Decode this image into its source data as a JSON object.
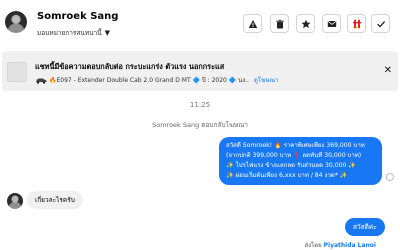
{
  "header": {
    "contact_name": "Somroek Sang",
    "assign_label": "มอบหมายการสนทนานี้",
    "tools": [
      "alert-icon",
      "trash-icon",
      "star-icon",
      "envelope-icon",
      "spam-icon",
      "check-icon"
    ]
  },
  "notice": {
    "title": "แชทนี้มีข้อความตอบกลับต่อ กระบะแกร่ง ตัวแรง นอกกระแส",
    "car_text": "🔥E097 - Extender Double Cab 2.0 Grand D MT 🔷 ปี : 2020 🔷 นง..",
    "link_text": "ดูโฆษณา"
  },
  "timeline": {
    "timestamp": "11:25",
    "system_note": "Somroek Sang ตอบกลับโฆษณา"
  },
  "messages": {
    "outgoing_lines": [
      "สวัสดี Somroek! 🔥 ราคาพิเศษเพียง 369,000 บาท",
      "(จากปกติ 399,000 บาท ❗ ลดทันที 30,000 บาท)",
      "✨ โปรไฟแรง ข้างแลกลด รับส่วนลด 30,000 ✨",
      "✨ ผ่อนเริ่มต้นเพียง 6,xxx บาท / 84 งวด* ✨"
    ],
    "incoming": "เกี่ยวละไรครับ",
    "outgoing_short": "สวัสดีค่ะ",
    "sent_by_label": "ส่งโดย",
    "sent_by_name": "Piyathida Lanoi"
  },
  "colors": {
    "accent": "#1877f2",
    "bubble_in": "#f0f0f0",
    "notice_bg": "#f0f0f0"
  }
}
